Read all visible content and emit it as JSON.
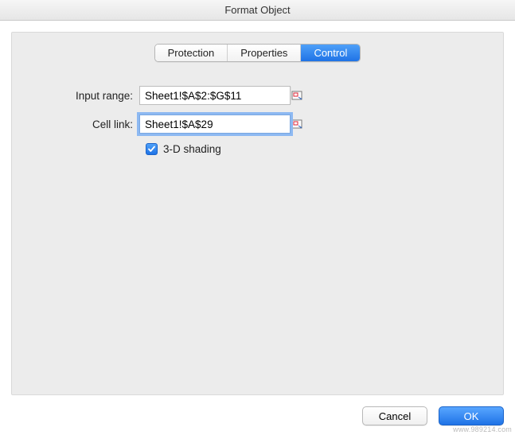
{
  "window": {
    "title": "Format Object"
  },
  "tabs": {
    "items": [
      {
        "label": "Protection",
        "active": false
      },
      {
        "label": "Properties",
        "active": false
      },
      {
        "label": "Control",
        "active": true
      }
    ]
  },
  "form": {
    "input_range": {
      "label": "Input range:",
      "value": "Sheet1!$A$2:$G$11"
    },
    "cell_link": {
      "label": "Cell link:",
      "value": "Sheet1!$A$29"
    },
    "shading": {
      "label": "3-D shading",
      "checked": true
    }
  },
  "footer": {
    "cancel": "Cancel",
    "ok": "OK"
  },
  "watermark": "www.989214.com"
}
